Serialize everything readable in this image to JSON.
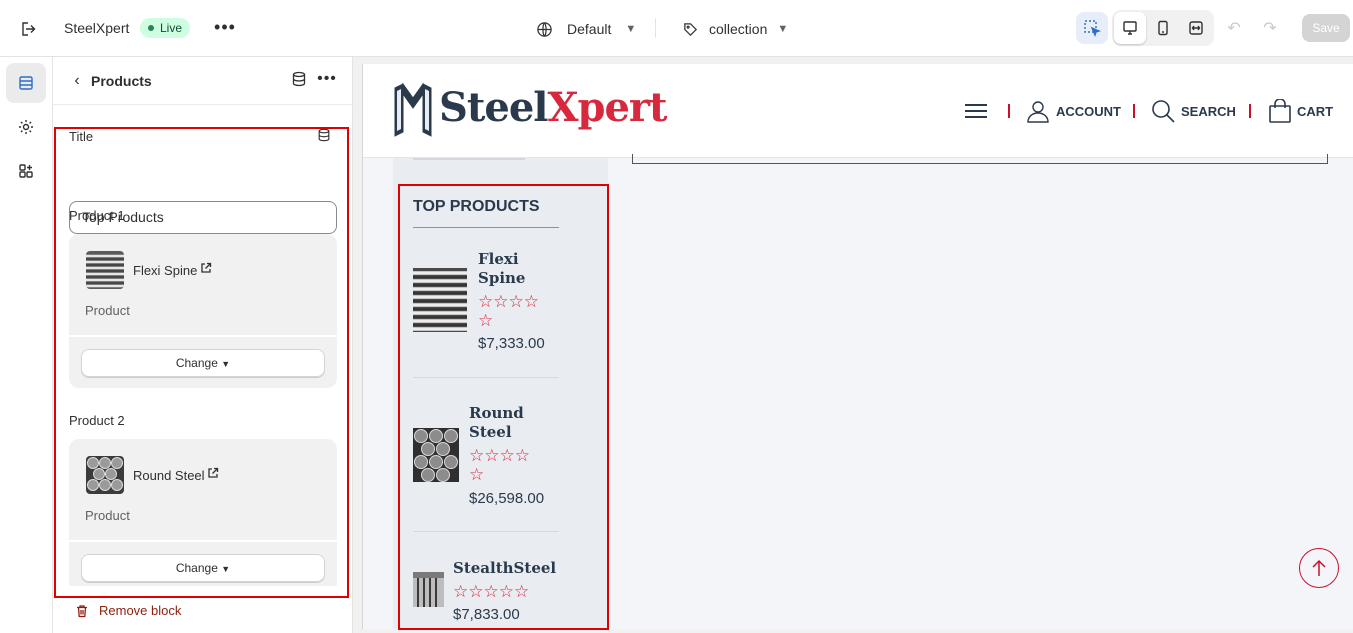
{
  "topbar": {
    "store_name": "SteelXpert",
    "status_badge": "Live",
    "theme_label": "Default",
    "template_label": "collection",
    "save_label": "Save"
  },
  "sidebar": {
    "header_title": "Products",
    "title_label": "Title",
    "title_value": "Top Products",
    "products": [
      {
        "label": "Product 1",
        "name": "Flexi Spine",
        "type": "Product",
        "change_label": "Change"
      },
      {
        "label": "Product 2",
        "name": "Round Steel",
        "type": "Product",
        "change_label": "Change"
      }
    ],
    "remove_label": "Remove block"
  },
  "preview": {
    "logo_part1": "Steel",
    "logo_part2": "Xpert",
    "nav": {
      "account": "ACCOUNT",
      "search": "SEARCH",
      "cart": "CART"
    },
    "section_heading": "TOP PRODUCTS",
    "products": [
      {
        "name_line1": "Flexi",
        "name_line2": "Spine",
        "stars": "☆☆☆☆",
        "stars_extra": "☆",
        "price": "$7,333.00"
      },
      {
        "name_line1": "Round",
        "name_line2": "Steel",
        "stars": "☆☆☆☆",
        "stars_extra": "☆",
        "price": "$26,598.00"
      },
      {
        "name_line1": "StealthSteel",
        "stars": "☆☆☆☆☆",
        "price": "$7,833.00"
      }
    ]
  },
  "colors": {
    "brand_red": "#d7283d",
    "brand_navy": "#2a3a4c",
    "highlight": "#e00000"
  }
}
